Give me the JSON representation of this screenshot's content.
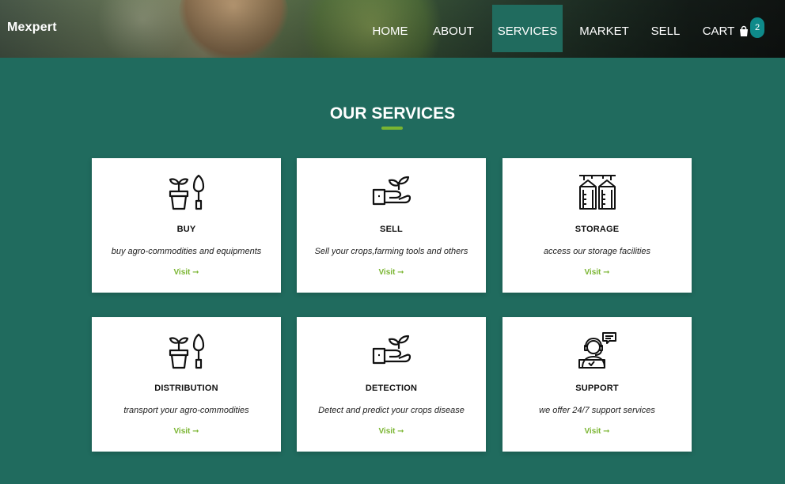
{
  "brand": {
    "logo": "Mexpert"
  },
  "nav": {
    "items": [
      "HOME",
      "ABOUT",
      "SERVICES",
      "MARKET",
      "SELL",
      "CART"
    ],
    "active": "SERVICES",
    "cart_count": "2"
  },
  "section": {
    "title": "OUR SERVICES"
  },
  "services": [
    {
      "title": "BUY",
      "description": "buy agro-commodities and equipments",
      "link": "Visit ➞",
      "icon": "plant-pot-shovel-icon"
    },
    {
      "title": "SELL",
      "description": "Sell your crops,farming tools and others",
      "link": "Visit ➞",
      "icon": "hand-sprout-icon"
    },
    {
      "title": "STORAGE",
      "description": "access our storage facilities",
      "link": "Visit ➞",
      "icon": "silo-icon"
    },
    {
      "title": "DISTRIBUTION",
      "description": "transport your agro-commodities",
      "link": "Visit ➞",
      "icon": "plant-pot-shovel-icon"
    },
    {
      "title": "DETECTION",
      "description": "Detect and predict your crops disease",
      "link": "Visit ➞",
      "icon": "hand-sprout-icon"
    },
    {
      "title": "SUPPORT",
      "description": "we offer 24/7 support services",
      "link": "Visit ➞",
      "icon": "support-agent-icon"
    }
  ],
  "colors": {
    "background": "#206b5e",
    "accent": "#7ab531",
    "badge": "#0e8a8a"
  }
}
